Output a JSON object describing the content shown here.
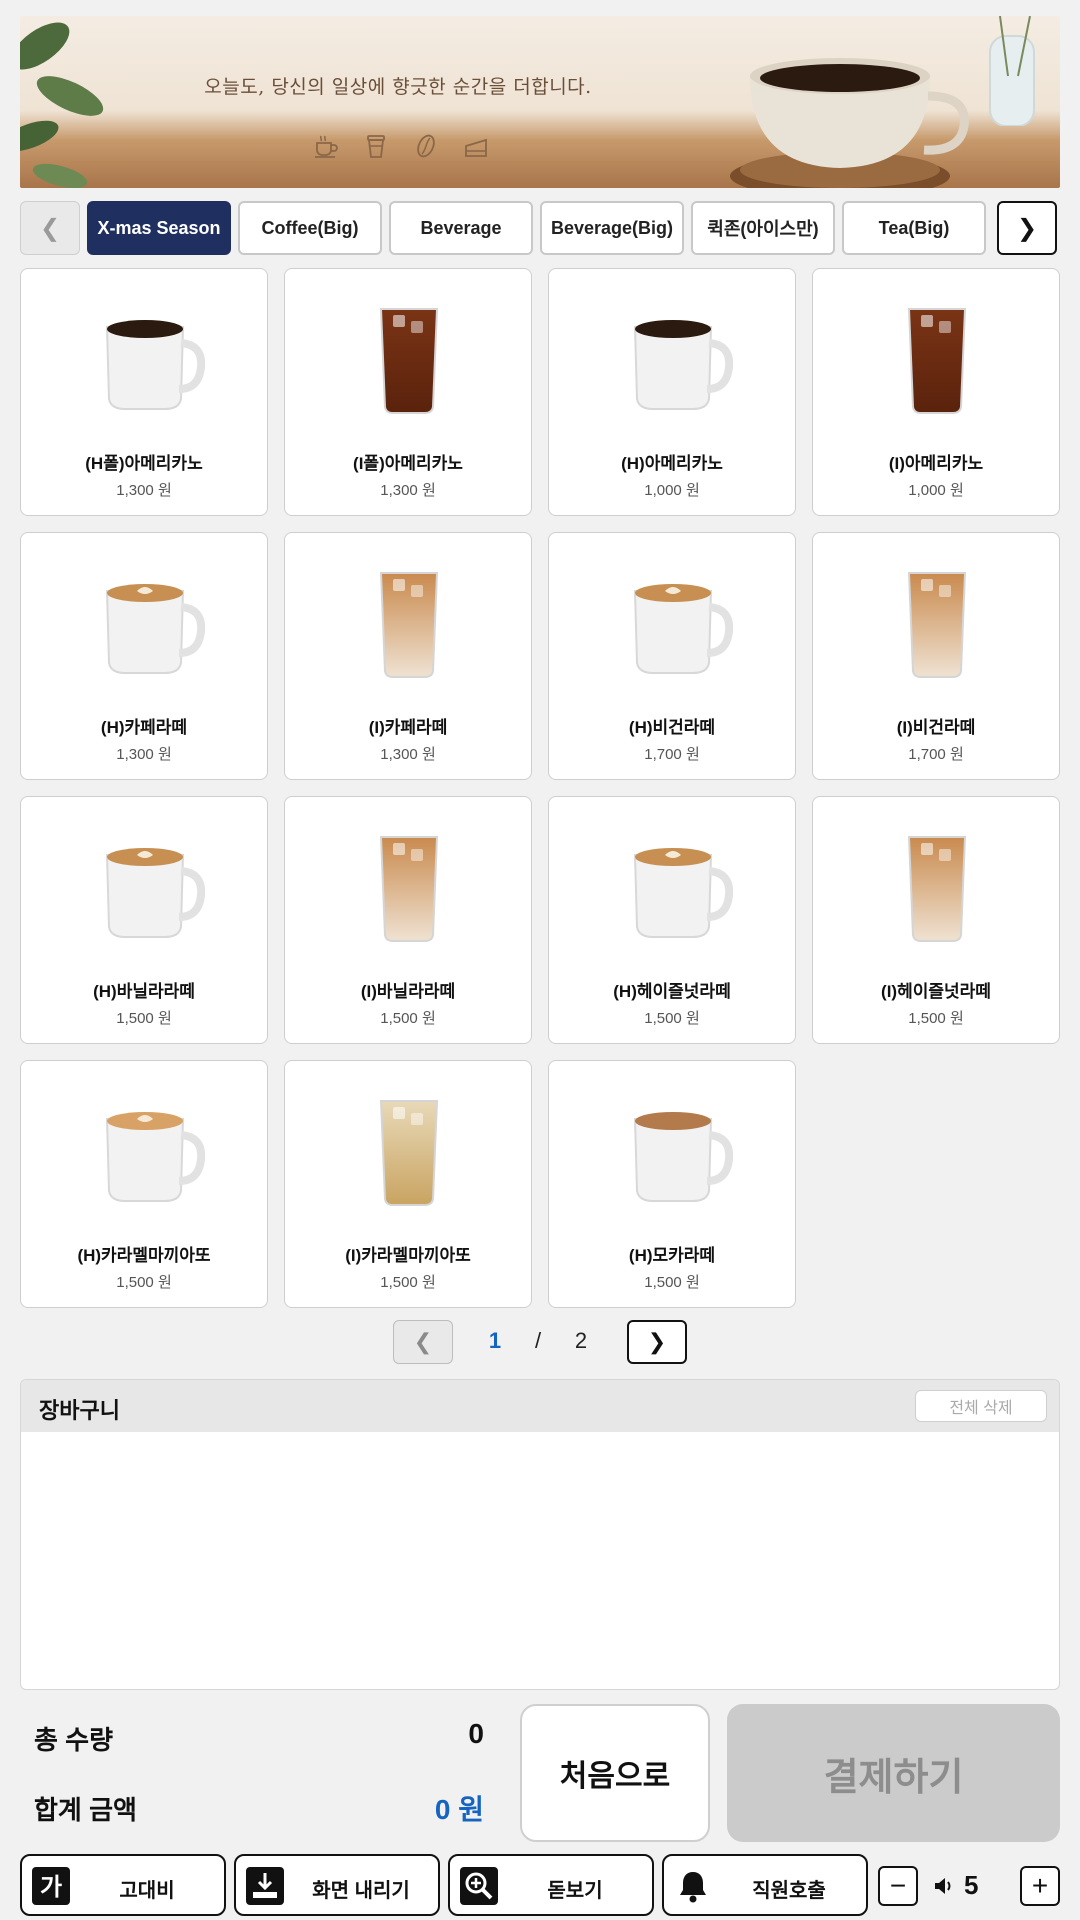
{
  "banner": {
    "tagline": "오늘도, 당신의 일상에 향긋한 순간을 더합니다.",
    "icons": [
      "coffee-cup-icon",
      "takeout-cup-icon",
      "coffee-bean-icon",
      "cake-icon"
    ]
  },
  "tabs": {
    "items": [
      {
        "label": "X-mas Season",
        "active": true
      },
      {
        "label": "Coffee(Big)",
        "active": false
      },
      {
        "label": "Beverage",
        "active": false
      },
      {
        "label": "Beverage(Big)",
        "active": false
      },
      {
        "label": "퀵존(아이스만)",
        "active": false
      },
      {
        "label": "Tea(Big)",
        "active": false
      }
    ]
  },
  "menu": {
    "items": [
      {
        "name": "(H폴)아메리카노",
        "price": "1,300 원",
        "image": "hot-americano"
      },
      {
        "name": "(I폴)아메리카노",
        "price": "1,300 원",
        "image": "iced-americano"
      },
      {
        "name": "(H)아메리카노",
        "price": "1,000 원",
        "image": "hot-americano"
      },
      {
        "name": "(I)아메리카노",
        "price": "1,000 원",
        "image": "iced-americano"
      },
      {
        "name": "(H)카페라떼",
        "price": "1,300 원",
        "image": "hot-latte"
      },
      {
        "name": "(I)카페라떼",
        "price": "1,300 원",
        "image": "iced-latte"
      },
      {
        "name": "(H)비건라떼",
        "price": "1,700 원",
        "image": "hot-latte"
      },
      {
        "name": "(I)비건라떼",
        "price": "1,700 원",
        "image": "iced-latte"
      },
      {
        "name": "(H)바닐라라떼",
        "price": "1,500 원",
        "image": "hot-latte"
      },
      {
        "name": "(I)바닐라라떼",
        "price": "1,500 원",
        "image": "iced-latte"
      },
      {
        "name": "(H)헤이즐넛라떼",
        "price": "1,500 원",
        "image": "hot-latte"
      },
      {
        "name": "(I)헤이즐넛라떼",
        "price": "1,500 원",
        "image": "iced-latte"
      },
      {
        "name": "(H)카라멜마끼아또",
        "price": "1,500 원",
        "image": "hot-caramel"
      },
      {
        "name": "(I)카라멜마끼아또",
        "price": "1,500 원",
        "image": "iced-caramel"
      },
      {
        "name": "(H)모카라떼",
        "price": "1,500 원",
        "image": "hot-mocha"
      }
    ]
  },
  "pager": {
    "current": "1",
    "separator": "/",
    "total": "2"
  },
  "cart": {
    "title": "장바구니",
    "clear_all": "전체 삭제"
  },
  "totals": {
    "qty_label": "총 수량",
    "qty_value": "0",
    "amount_label": "합계 금액",
    "amount_value": "0 원"
  },
  "actions": {
    "home": "처음으로",
    "pay": "결제하기"
  },
  "bottombar": {
    "high_contrast": "고대비",
    "lower_screen": "화면 내리기",
    "magnifier": "돋보기",
    "call_staff": "직원호출",
    "volume": "5"
  },
  "colors": {
    "accent": "#1f2f5f",
    "price_blue": "#1565c0",
    "pay_disabled": "#cbcbcb"
  }
}
